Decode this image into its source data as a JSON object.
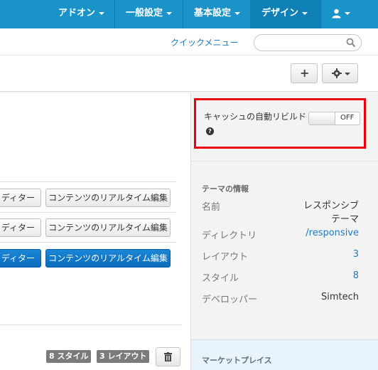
{
  "topnav": {
    "addons": "アドオン",
    "general_settings": "一般設定",
    "basic_settings": "基本設定",
    "design": "デザイン"
  },
  "quickbar": {
    "quick_menu": "クイックメニュー",
    "search_placeholder": ""
  },
  "toolbar": {
    "add_label": "+"
  },
  "content": {
    "rows": [
      {
        "editor_label": "ディター",
        "live_edit_label": "コンテンツのリアルタイム編集"
      },
      {
        "editor_label": "ディター",
        "live_edit_label": "コンテンツのリアルタイム編集"
      },
      {
        "editor_label": "ディター",
        "live_edit_label": "コンテンツのリアルタイム編集"
      }
    ],
    "styles_badge": "8 スタイル",
    "layouts_badge": "3 レイアウト"
  },
  "sidebar": {
    "cache_label": "キャッシュの自動リビルド",
    "toggle_state": "OFF",
    "help_glyph": "?",
    "theme_info_title": "テーマの情報",
    "info": [
      {
        "key": "名前",
        "value": "レスポンシブ テーマ"
      },
      {
        "key": "ディレクトリ",
        "value": "/responsive"
      },
      {
        "key": "レイアウト",
        "value": "3"
      },
      {
        "key": "スタイル",
        "value": "8"
      },
      {
        "key": "デベロッパー",
        "value": "Simtech"
      }
    ],
    "marketplace": "マーケットプレイス"
  },
  "colors": {
    "nav_bg": "#1a93c9",
    "primary": "#0b6bbc",
    "highlight_border": "#e8000e",
    "link": "#1f7ac0"
  }
}
